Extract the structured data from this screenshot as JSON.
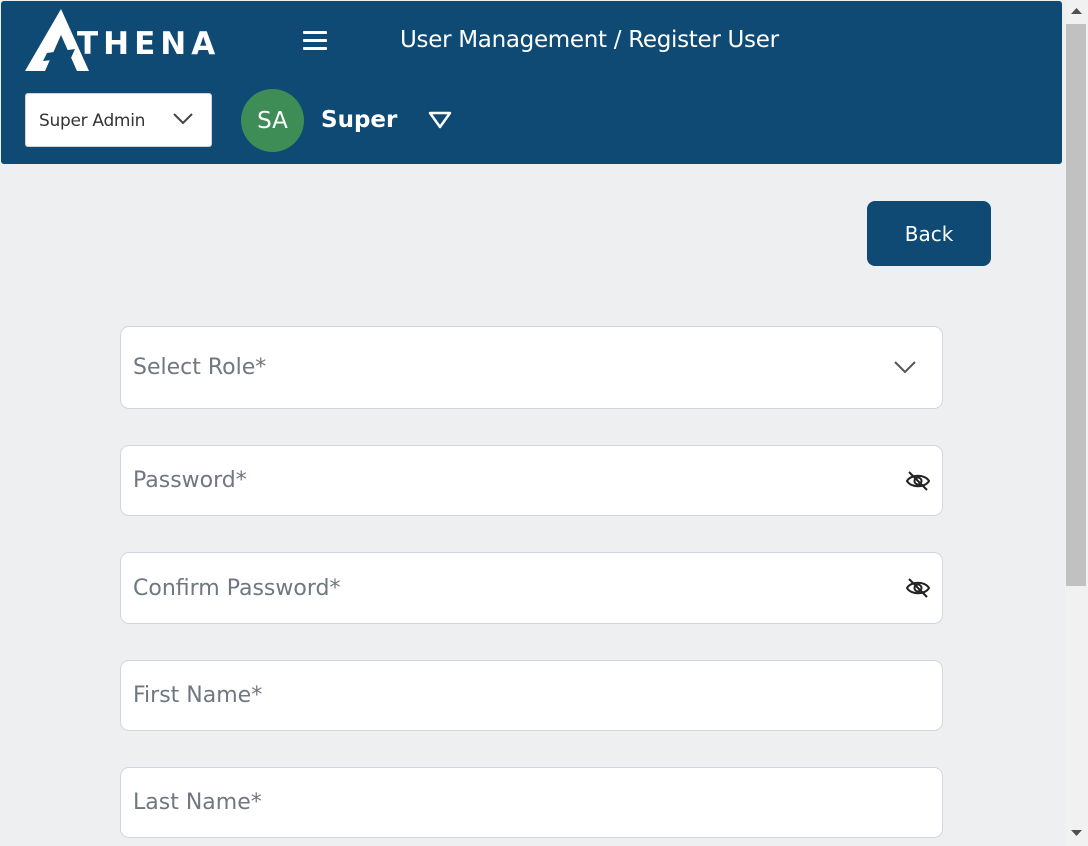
{
  "header": {
    "logo_text": "THENA",
    "breadcrumb": "User Management / Register User",
    "org_select": {
      "value": "Super Admin"
    },
    "user": {
      "initials": "SA",
      "name": "Super",
      "avatar_color": "#3e8d57"
    },
    "bg_color": "#0e4a74"
  },
  "actions": {
    "back_label": "Back"
  },
  "form": {
    "role_select": {
      "placeholder": "Select Role*",
      "icon": "chevron-down-icon"
    },
    "password": {
      "placeholder": "Password*",
      "icon": "eye-off-icon"
    },
    "confirm_password": {
      "placeholder": "Confirm Password*",
      "icon": "eye-off-icon"
    },
    "first_name": {
      "placeholder": "First Name*"
    },
    "last_name": {
      "placeholder": "Last Name*"
    }
  }
}
